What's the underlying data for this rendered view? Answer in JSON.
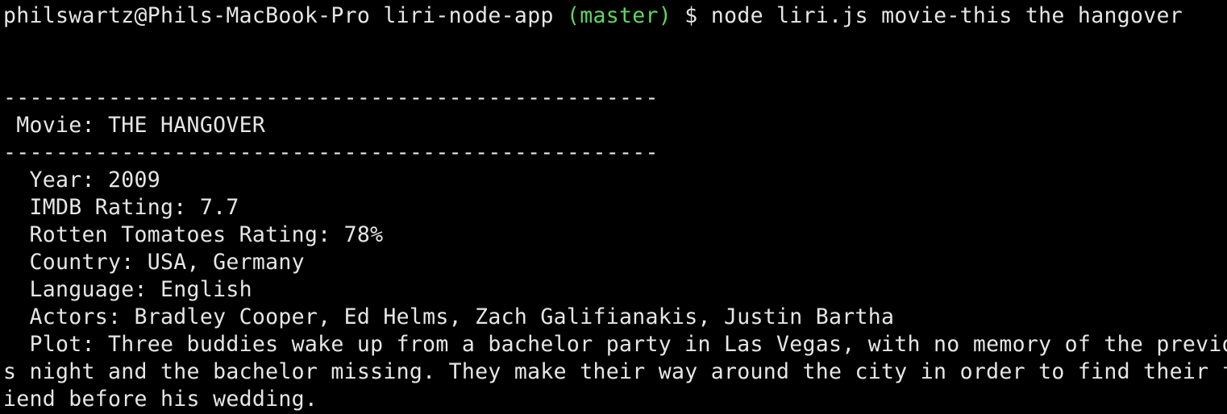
{
  "prompt": {
    "user_host": "philswartz@Phils-MacBook-Pro",
    "cwd": "liri-node-app",
    "branch": "(master)",
    "symbol": "$",
    "command": "node liri.js movie-this the hangover"
  },
  "output": {
    "divider": "--------------------------------------------------",
    "movie_line": " Movie: THE HANGOVER",
    "fields": [
      "  Year: 2009",
      "  IMDB Rating: 7.7",
      "  Rotten Tomatoes Rating: 78%",
      "  Country: USA, Germany",
      "  Language: English",
      "  Actors: Bradley Cooper, Ed Helms, Zach Galifianakis, Justin Bartha",
      "  Plot: Three buddies wake up from a bachelor party in Las Vegas, with no memory of the previou",
      "s night and the bachelor missing. They make their way around the city in order to find their fr",
      "iend before his wedding."
    ]
  },
  "colors": {
    "background": "#000000",
    "text": "#e6e6e6",
    "branch": "#5fd75f"
  }
}
